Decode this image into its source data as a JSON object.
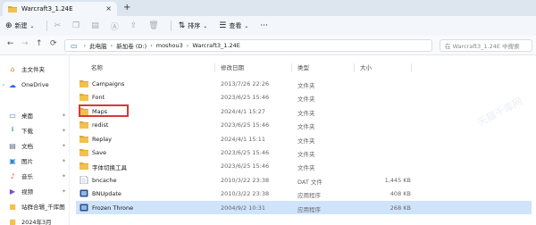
{
  "tab": {
    "title": "Warcraft3_1.24E",
    "close": "×",
    "new": "+"
  },
  "commands": {
    "new_label": "新建",
    "sort_label": "排序",
    "view_label": "查看",
    "more": "···"
  },
  "address": {
    "crumbs": [
      "此电脑",
      "新加卷 (D:)",
      "moshou3",
      "Warcraft3_1.24E"
    ],
    "search_placeholder": "在 Warcraft3_1.24E 中搜索"
  },
  "sidebar": {
    "items": [
      {
        "label": "主文件夹",
        "icon": "home-icon",
        "glyph": "⌂"
      },
      {
        "label": "OneDrive",
        "icon": "cloud-icon",
        "glyph": "☁"
      },
      {
        "label": "桌面",
        "icon": "desktop-icon",
        "glyph": "▭"
      },
      {
        "label": "下载",
        "icon": "download-icon",
        "glyph": "⭳"
      },
      {
        "label": "文档",
        "icon": "document-icon",
        "glyph": "▤"
      },
      {
        "label": "图片",
        "icon": "picture-icon",
        "glyph": "▣"
      },
      {
        "label": "音乐",
        "icon": "music-icon",
        "glyph": "♪"
      },
      {
        "label": "视频",
        "icon": "video-icon",
        "glyph": "▶"
      },
      {
        "label": "站群合辑_千库图",
        "icon": "folder-icon",
        "glyph": "■"
      },
      {
        "label": "2024年3月",
        "icon": "folder-icon",
        "glyph": "■"
      }
    ]
  },
  "columns": {
    "name": "名称",
    "date": "修改日期",
    "type": "类型",
    "size": "大小"
  },
  "files": [
    {
      "name": "Campaigns",
      "date": "2013/7/26 22:26",
      "type": "文件夹",
      "size": "",
      "icon": "folder-icon"
    },
    {
      "name": "Font",
      "date": "2023/6/25 15:46",
      "type": "文件夹",
      "size": "",
      "icon": "folder-icon"
    },
    {
      "name": "Maps",
      "date": "2024/4/1 15:27",
      "type": "文件夹",
      "size": "",
      "icon": "folder-icon"
    },
    {
      "name": "redist",
      "date": "2023/6/25 15:46",
      "type": "文件夹",
      "size": "",
      "icon": "folder-icon"
    },
    {
      "name": "Replay",
      "date": "2024/4/1 15:11",
      "type": "文件夹",
      "size": "",
      "icon": "folder-icon"
    },
    {
      "name": "Save",
      "date": "2023/6/25 15:46",
      "type": "文件夹",
      "size": "",
      "icon": "folder-icon"
    },
    {
      "name": "字体切换工具",
      "date": "2023/6/25 15:46",
      "type": "文件夹",
      "size": "",
      "icon": "folder-icon"
    },
    {
      "name": "bncache",
      "date": "2010/3/22 23:38",
      "type": "DAT 文件",
      "size": "1,445 KB",
      "icon": "file-icon"
    },
    {
      "name": "BNUpdate",
      "date": "2010/3/22 23:38",
      "type": "应用程序",
      "size": "408 KB",
      "icon": "app-icon"
    },
    {
      "name": "Frozen Throne",
      "date": "2004/9/2 10:31",
      "type": "应用程序",
      "size": "268 KB",
      "icon": "app-icon"
    }
  ],
  "watermark": "天猫千库网"
}
